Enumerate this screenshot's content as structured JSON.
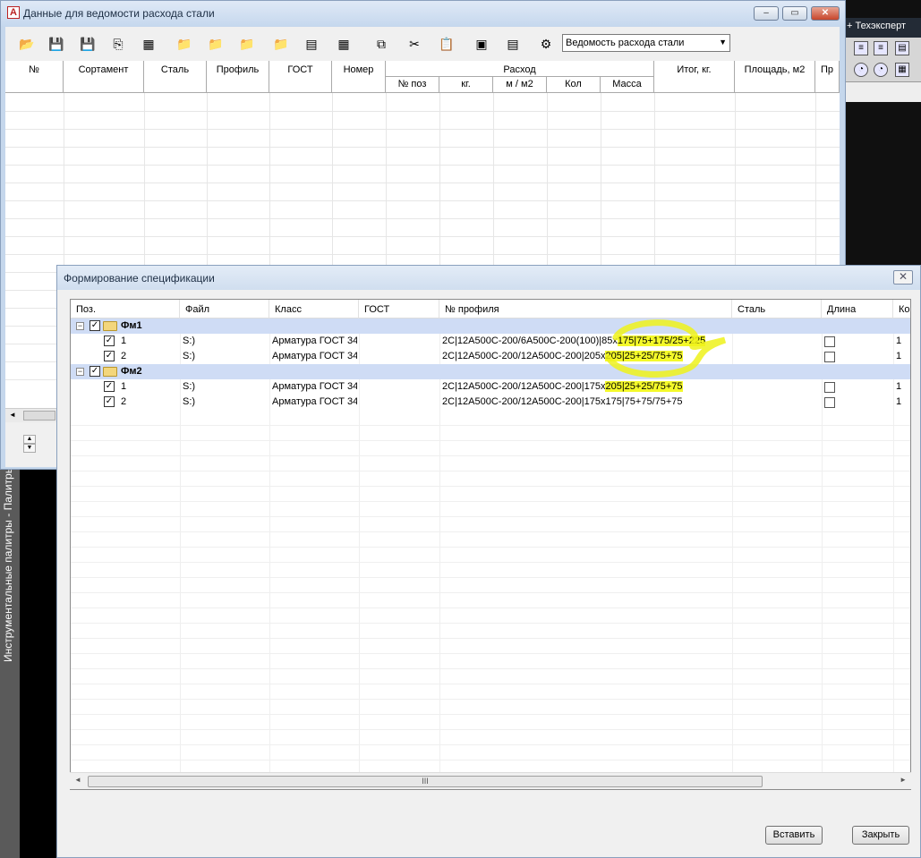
{
  "right_app": {
    "header": "+   Техэксперт"
  },
  "palette_bar": {
    "label": "Инструментальные палитры - Палитры"
  },
  "main_window": {
    "title": "Данные для ведомости расхода стали",
    "combo_value": "Ведомость расхода стали",
    "columns": [
      "№",
      "Сортамент",
      "Сталь",
      "Профиль",
      "ГОСТ",
      "Номер",
      "Расход",
      "Итог, кг.",
      "Площадь, м2",
      "Пр"
    ],
    "subcolumns": [
      "№ поз",
      "кг.",
      "м / м2",
      "Кол",
      "Масса"
    ]
  },
  "spec_dialog": {
    "title": "Формирование спецификации",
    "columns": [
      "Поз.",
      "Файл",
      "Класс",
      "ГОСТ",
      "№ профиля",
      "Сталь",
      "Длина",
      "Ко."
    ],
    "groups": [
      {
        "name": "Фм1",
        "rows": [
          {
            "pos": "1",
            "file": "S:)",
            "class": "Арматура ГОСТ 34",
            "profile_a": "2С|12А500С-200/6А500С-200(100)|85х",
            "profile_b": "175|75+175/25+225",
            "count": "1"
          },
          {
            "pos": "2",
            "file": "S:)",
            "class": "Арматура ГОСТ 34",
            "profile_a": "2С|12А500С-200/12А500С-200|205х",
            "profile_b": "205|25+25/75+75",
            "count": "1"
          }
        ]
      },
      {
        "name": "Фм2",
        "rows": [
          {
            "pos": "1",
            "file": "S:)",
            "class": "Арматура ГОСТ 34",
            "profile_a": "2С|12А500С-200/12А500С-200|175х",
            "profile_b": "205|25+25/75+75",
            "count": "1"
          },
          {
            "pos": "2",
            "file": "S:)",
            "class": "Арматура ГОСТ 34",
            "profile_a": "2С|12А500С-200/12А500С-200|175х175|",
            "profile_b": "75+75/75+75",
            "count": "1"
          }
        ]
      }
    ],
    "scroll_grip": "III",
    "insert_button": "Вставить",
    "close_button": "Закрыть"
  }
}
